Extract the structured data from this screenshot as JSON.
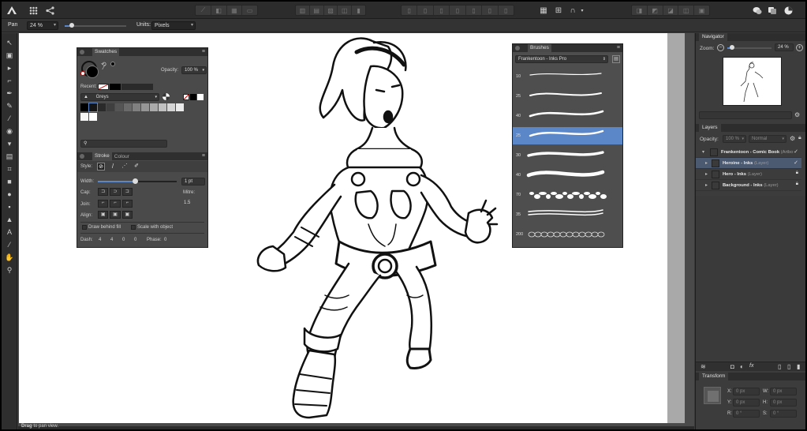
{
  "context": {
    "tool_label": "Pan",
    "zoom_value": "24 %",
    "units_label": "Units:",
    "units_value": "Pixels"
  },
  "swatches": {
    "title": "Swatches",
    "opacity_label": "Opacity:",
    "opacity_value": "100 %",
    "recent_label": "Recent:",
    "palette_name": "Greys",
    "colors": {
      "grey_ramp": [
        "#000000",
        "#151515",
        "#2a2a2a",
        "#3f3f3f",
        "#555555",
        "#6a6a6a",
        "#808080",
        "#959595",
        "#aaaaaa",
        "#c0c0c0",
        "#d5d5d5",
        "#eaeaea",
        "#f5f5f5",
        "#ffffff"
      ]
    }
  },
  "stroke": {
    "tab_stroke": "Stroke",
    "tab_colour": "Colour",
    "style_label": "Style:",
    "width_label": "Width:",
    "width_value": "1 pt",
    "cap_label": "Cap:",
    "join_label": "Join:",
    "mitre_label": "Mitre:",
    "mitre_value": "1.5",
    "align_label": "Align:",
    "draw_behind_fill": "Draw behind fill",
    "scale_with_object": "Scale with object",
    "dash_label": "Dash:",
    "dash_values": [
      "4",
      "4",
      "0",
      "0"
    ],
    "phase_label": "Phase:",
    "phase_value": "0"
  },
  "brushes": {
    "title": "Brushes",
    "category": "Frankentoon - Inks Pro",
    "sizes": [
      "10",
      "25",
      "40",
      "25",
      "30",
      "40",
      "70",
      "35",
      "200"
    ],
    "selected_index": 3
  },
  "navigator": {
    "title": "Navigator",
    "zoom_label": "Zoom:",
    "zoom_value": "24 %"
  },
  "layers": {
    "title": "Layers",
    "opacity_label": "Opacity:",
    "opacity_value": "100 %",
    "blend_mode": "Normal",
    "items": [
      {
        "name": "Frankentoon - Comic Book",
        "type": "(Artbo"
      },
      {
        "name": "Heroine - Inks",
        "type": "(Layer)"
      },
      {
        "name": "Hero - Inks",
        "type": "(Layer)"
      },
      {
        "name": "Background - Inks",
        "type": "(Layer)"
      }
    ]
  },
  "transform": {
    "title": "Transform",
    "x_label": "X:",
    "x_value": "0 px",
    "y_label": "Y:",
    "y_value": "0 px",
    "w_label": "W:",
    "w_value": "0 px",
    "h_label": "H:",
    "h_value": "0 px",
    "r_label": "R:",
    "r_value": "0 °",
    "s_label": "S:",
    "s_value": "0 °"
  },
  "status": {
    "hint_bold": "Drag",
    "hint_rest": "to pan view."
  },
  "colors": {
    "selection_blue": "#5b86c8",
    "panel_bg": "#4a4a4a",
    "toolbar_bg": "#2c2c2c"
  }
}
